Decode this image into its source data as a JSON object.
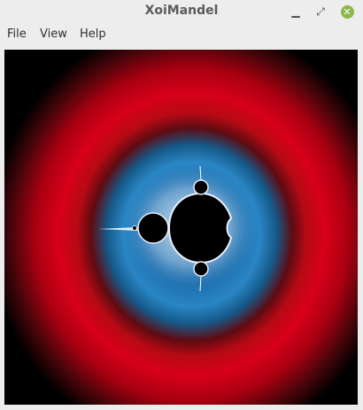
{
  "window": {
    "title": "XoiMandel"
  },
  "menu": {
    "items": [
      "File",
      "View",
      "Help"
    ]
  },
  "colors": {
    "fractal_inner": "#000000",
    "band_blue": "#2a86c4",
    "band_red": "#d8001a",
    "edge_glow": "#ffffff"
  },
  "icons": {
    "minimize": "minimize-icon",
    "maximize": "maximize-icon",
    "close": "close-icon"
  }
}
